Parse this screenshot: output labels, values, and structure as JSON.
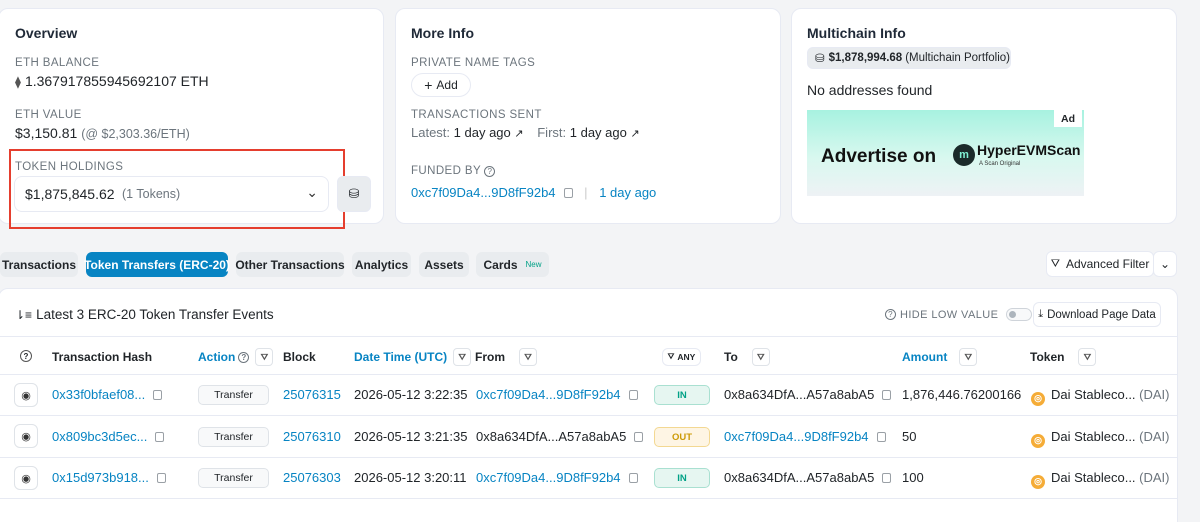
{
  "overview": {
    "title": "Overview",
    "eth_balance_label": "ETH BALANCE",
    "eth_balance_value": "1.367917855945692107 ETH",
    "eth_value_label": "ETH VALUE",
    "eth_value_amount": "$3,150.81",
    "eth_value_rate": "(@ $2,303.36/ETH)",
    "token_holdings_label": "TOKEN HOLDINGS",
    "token_holdings_value": "$1,875,845.62",
    "token_holdings_count": "(1 Tokens)"
  },
  "more_info": {
    "title": "More Info",
    "private_tags_label": "PRIVATE NAME TAGS",
    "add_label": "Add",
    "tx_sent_label": "TRANSACTIONS SENT",
    "latest_label": "Latest:",
    "latest_value": "1 day ago",
    "first_label": "First:",
    "first_value": "1 day ago",
    "funded_by_label": "FUNDED BY",
    "funded_by_address": "0xc7f09Da4...9D8fF92b4",
    "funded_by_time": "1 day ago"
  },
  "multichain": {
    "title": "Multichain Info",
    "portfolio_value": "$1,878,994.68",
    "portfolio_label": "(Multichain Portfolio)",
    "no_addresses": "No addresses found",
    "ad_badge": "Ad",
    "ad_text": "Advertise on",
    "ad_brand": "HyperEVMScan",
    "ad_tagline": "A Scan Original"
  },
  "tabs": [
    {
      "label": "Transactions"
    },
    {
      "label": "Token Transfers (ERC-20)"
    },
    {
      "label": "Other Transactions"
    },
    {
      "label": "Analytics"
    },
    {
      "label": "Assets"
    },
    {
      "label": "Cards",
      "badge": "New"
    }
  ],
  "advanced_filter_label": "Advanced Filter",
  "table": {
    "title": "Latest 3 ERC-20 Token Transfer Events",
    "hide_low_value": "HIDE LOW VALUE",
    "download_label": "Download Page Data",
    "headers": {
      "tx_hash": "Transaction Hash",
      "action": "Action",
      "block": "Block",
      "datetime": "Date Time (UTC)",
      "from": "From",
      "any": "ANY",
      "to": "To",
      "amount": "Amount",
      "token": "Token"
    },
    "rows": [
      {
        "hash": "0x33f0bfaef08...",
        "method": "Transfer",
        "block": "25076315",
        "datetime": "2026-05-12 3:22:35",
        "from": "0xc7f09Da4...9D8fF92b4",
        "direction": "IN",
        "to": "0x8a634DfA...A57a8abA5",
        "amount": "1,876,446.76200166",
        "token_name": "Dai Stableco...",
        "token_symbol": "(DAI)"
      },
      {
        "hash": "0x809bc3d5ec...",
        "method": "Transfer",
        "block": "25076310",
        "datetime": "2026-05-12 3:21:35",
        "from": "0x8a634DfA...A57a8abA5",
        "direction": "OUT",
        "to": "0xc7f09Da4...9D8fF92b4",
        "amount": "50",
        "token_name": "Dai Stableco...",
        "token_symbol": "(DAI)"
      },
      {
        "hash": "0x15d973b918...",
        "method": "Transfer",
        "block": "25076303",
        "datetime": "2026-05-12 3:20:11",
        "from": "0xc7f09Da4...9D8fF92b4",
        "direction": "IN",
        "to": "0x8a634DfA...A57a8abA5",
        "amount": "100",
        "token_name": "Dai Stableco...",
        "token_symbol": "(DAI)"
      }
    ]
  },
  "colors": {
    "accent": "#0784c3",
    "highlight_border": "#e53e2e",
    "in_badge": "#00a186",
    "out_badge": "#cc9a06"
  }
}
